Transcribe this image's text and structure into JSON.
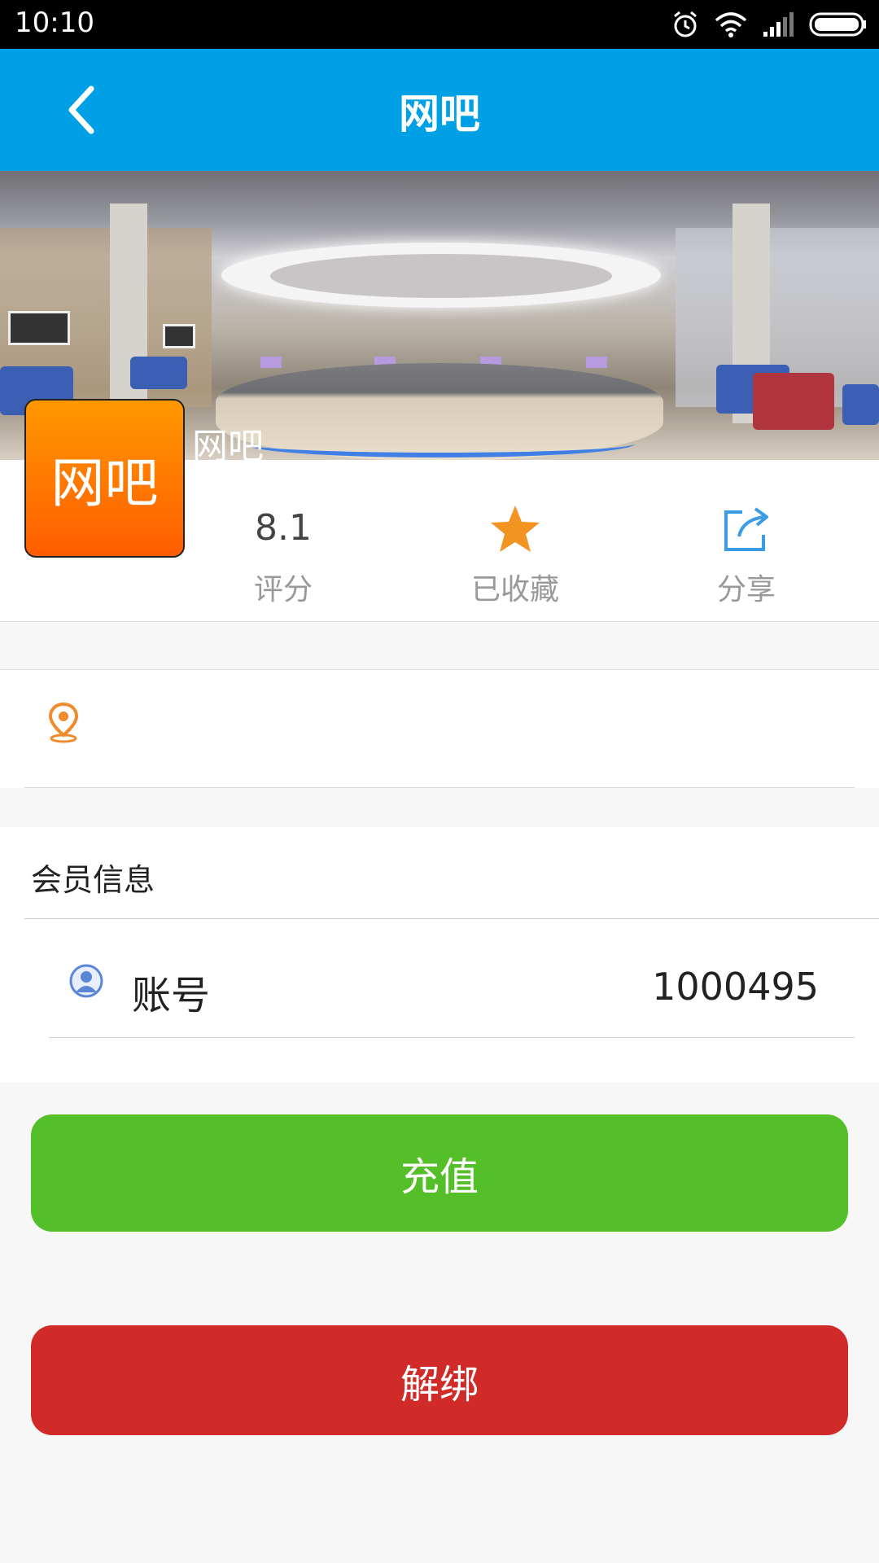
{
  "status_bar": {
    "time": "10:10"
  },
  "header": {
    "title": "网吧"
  },
  "shop": {
    "logo_text": "网吧",
    "name": "网吧"
  },
  "stats": {
    "rating": {
      "value": "8.1",
      "label": "评分"
    },
    "favorite": {
      "label": "已收藏",
      "icon": "star-icon"
    },
    "share": {
      "label": "分享",
      "icon": "share-icon"
    }
  },
  "address": {
    "icon": "location-pin-icon",
    "text": ""
  },
  "member": {
    "title": "会员信息",
    "account_label": "账号",
    "account_value": "1000495"
  },
  "actions": {
    "recharge": "充值",
    "unbind": "解绑"
  },
  "colors": {
    "header": "#00a0e6",
    "recharge": "#55bf2a",
    "unbind": "#d02b28",
    "star": "#f39322",
    "logo": "#ff7a00"
  }
}
